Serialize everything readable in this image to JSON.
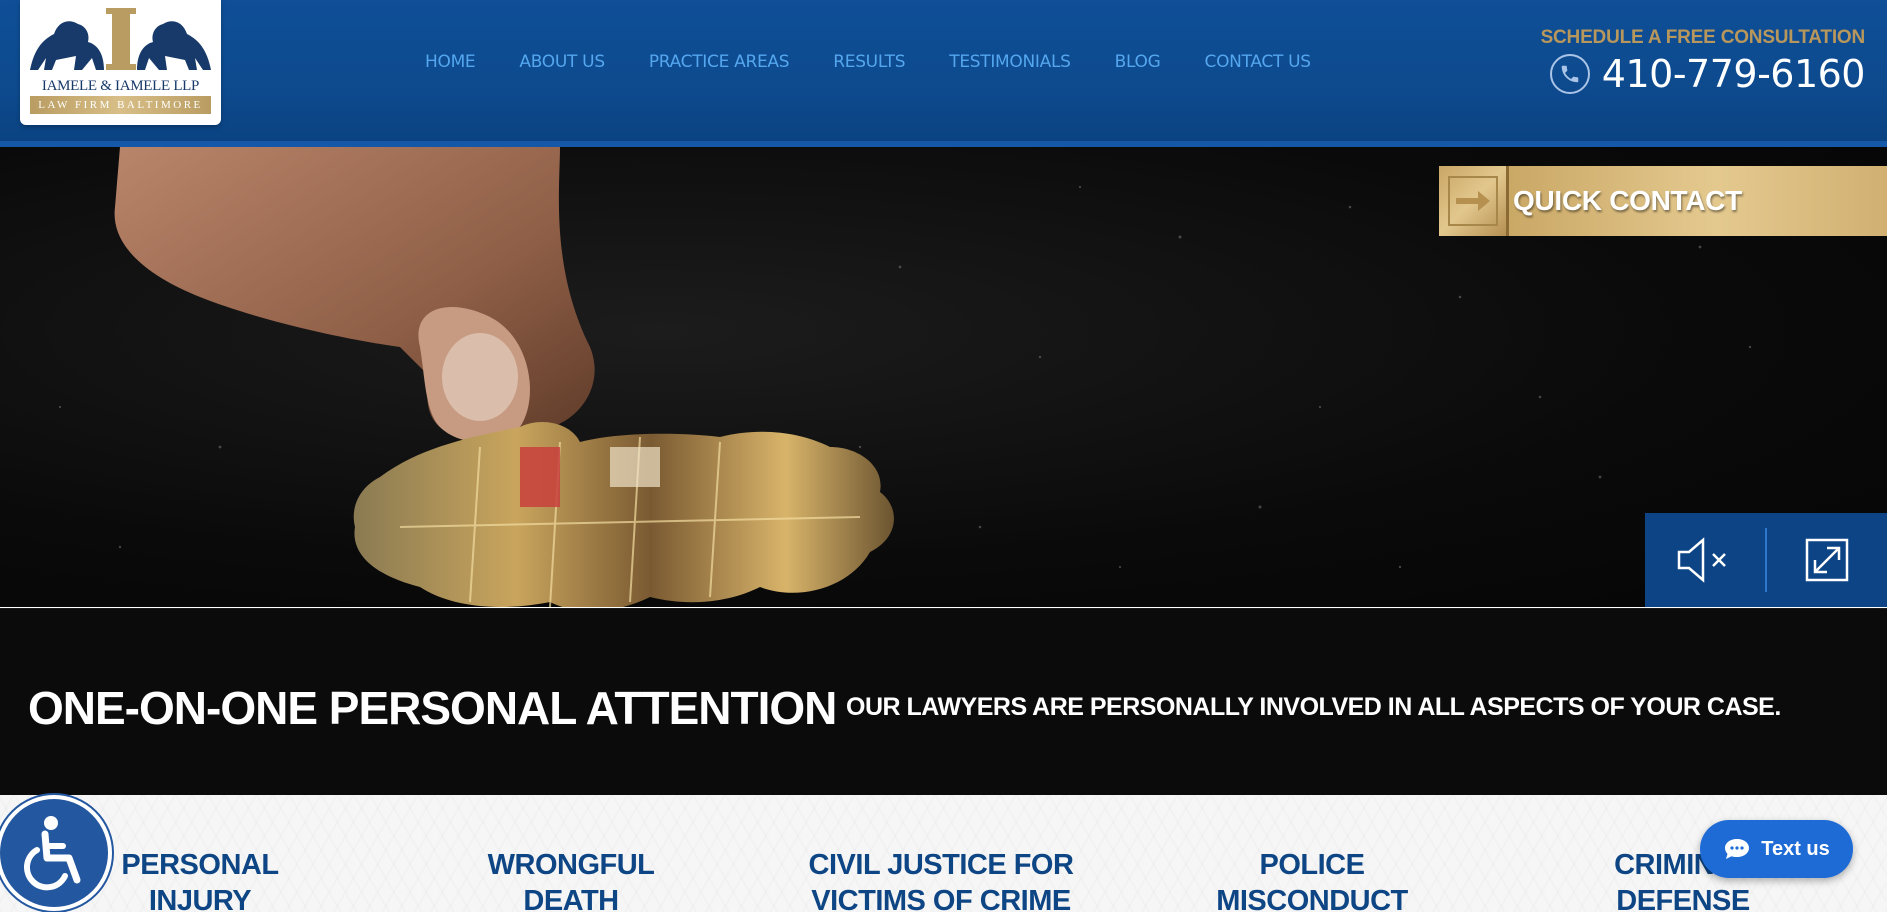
{
  "logo": {
    "firm_name": "IAMELE & IAMELE LLP",
    "tagline": "LAW FIRM BALTIMORE"
  },
  "nav": [
    {
      "label": "HOME"
    },
    {
      "label": "ABOUT US"
    },
    {
      "label": "PRACTICE AREAS"
    },
    {
      "label": "RESULTS"
    },
    {
      "label": "TESTIMONIALS"
    },
    {
      "label": "BLOG"
    },
    {
      "label": "CONTACT US"
    }
  ],
  "header": {
    "schedule_text": "SCHEDULE A FREE CONSULTATION",
    "phone": "410-779-6160"
  },
  "hero": {
    "quick_contact": "QUICK CONTACT",
    "caption_title": "ONE-ON-ONE PERSONAL ATTENTION",
    "caption_sub": "OUR LAWYERS ARE PERSONALLY INVOLVED IN ALL ASPECTS OF YOUR CASE."
  },
  "practice_areas": [
    {
      "line1": "PERSONAL",
      "line2": "INJURY"
    },
    {
      "line1": "WRONGFUL",
      "line2": "DEATH"
    },
    {
      "line1": "CIVIL JUSTICE FOR",
      "line2": "VICTIMS OF CRIME"
    },
    {
      "line1": "POLICE",
      "line2": "MISCONDUCT"
    },
    {
      "line1": "CRIMINAL",
      "line2": "DEFENSE"
    }
  ],
  "widgets": {
    "text_us": "Text us"
  },
  "colors": {
    "header_blue": "#0f4f97",
    "nav_link": "#54a6ee",
    "gold": "#b8975c",
    "practice_text": "#0e4584"
  }
}
